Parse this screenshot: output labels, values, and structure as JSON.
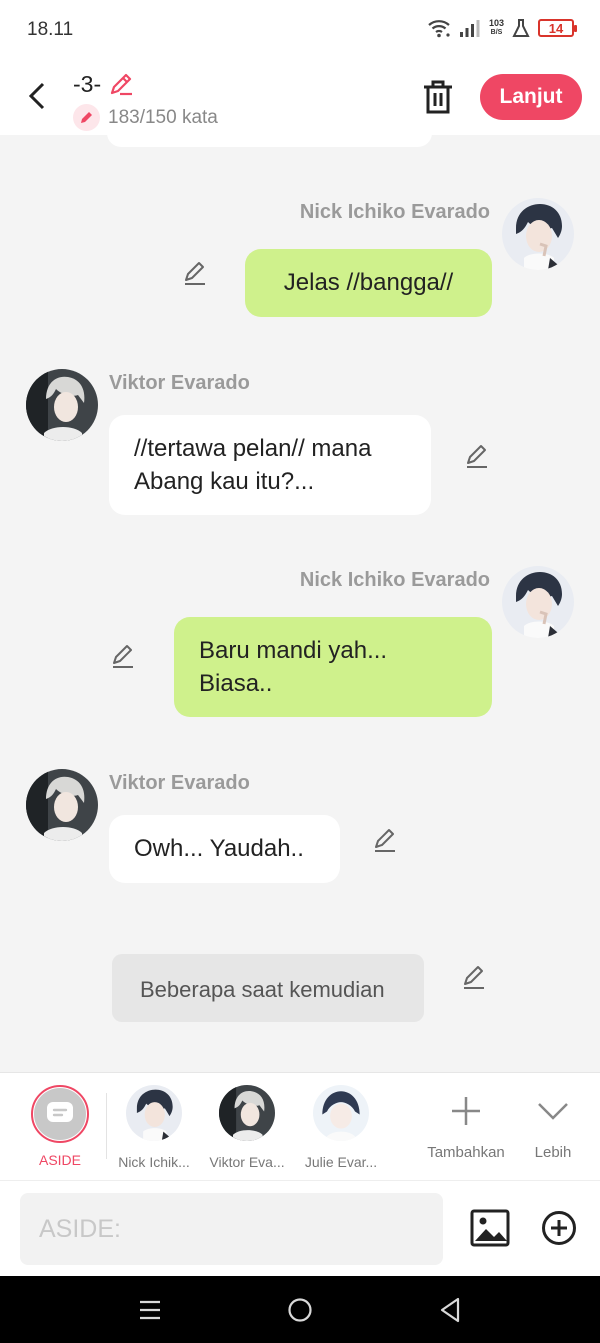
{
  "status_bar": {
    "time": "18.11",
    "net_speed_value": "103",
    "net_speed_unit": "B/S",
    "battery": "14"
  },
  "header": {
    "title": "-3-",
    "word_count": "183/150 kata",
    "next_label": "Lanjut",
    "accent_color": "#ef4764"
  },
  "messages": [
    {
      "side": "right",
      "sender": "Nick Ichiko Evarado",
      "text": "Jelas //bangga//",
      "bubble_color": "#cff18c"
    },
    {
      "side": "left",
      "sender": "Viktor Evarado",
      "text_line1": "//tertawa pelan// mana",
      "text_line2": "Abang kau itu?...",
      "bubble_color": "#ffffff"
    },
    {
      "side": "right",
      "sender": "Nick Ichiko Evarado",
      "text_line1": "Baru mandi yah...",
      "text_line2": "Biasa..",
      "bubble_color": "#cff18c"
    },
    {
      "side": "left",
      "sender": "Viktor Evarado",
      "text": "Owh... Yaudah..",
      "bubble_color": "#ffffff"
    },
    {
      "side": "center",
      "text": "Beberapa saat kemudian",
      "bubble_color": "#e6e6e6"
    }
  ],
  "characters": [
    {
      "label": "ASIDE",
      "icon": "aside-icon",
      "selected": true
    },
    {
      "label": "Nick Ichik...",
      "icon": "avatar"
    },
    {
      "label": "Viktor Eva...",
      "icon": "avatar"
    },
    {
      "label": "Julie Evar...",
      "icon": "avatar"
    }
  ],
  "tools": {
    "add_label": "Tambahkan",
    "more_label": "Lebih"
  },
  "input": {
    "placeholder": "ASIDE:",
    "value": ""
  }
}
